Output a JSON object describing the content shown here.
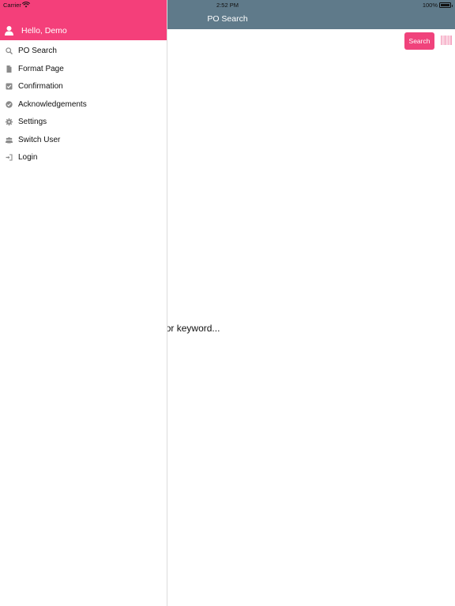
{
  "status_bar": {
    "carrier": "Carrier",
    "time": "2:52 PM",
    "battery": "100%"
  },
  "navbar": {
    "title": "PO Search"
  },
  "toolbar": {
    "search_label": "Search",
    "barcode_icon": "barcode-icon"
  },
  "main": {
    "prompt_text": "order number, barcode or keyword..."
  },
  "drawer": {
    "greeting": "Hello, Demo",
    "items": [
      {
        "label": "PO Search",
        "icon": "search-icon"
      },
      {
        "label": "Format Page",
        "icon": "document-icon"
      },
      {
        "label": "Confirmation",
        "icon": "checkbox-icon"
      },
      {
        "label": "Acknowledgements",
        "icon": "check-circle-icon"
      },
      {
        "label": "Settings",
        "icon": "gear-icon"
      },
      {
        "label": "Switch User",
        "icon": "users-icon"
      },
      {
        "label": "Login",
        "icon": "sign-in-icon"
      }
    ]
  },
  "colors": {
    "accent": "#f43f7a",
    "navbar": "#5f7a8a",
    "icon_gray": "#8a8a8a"
  }
}
